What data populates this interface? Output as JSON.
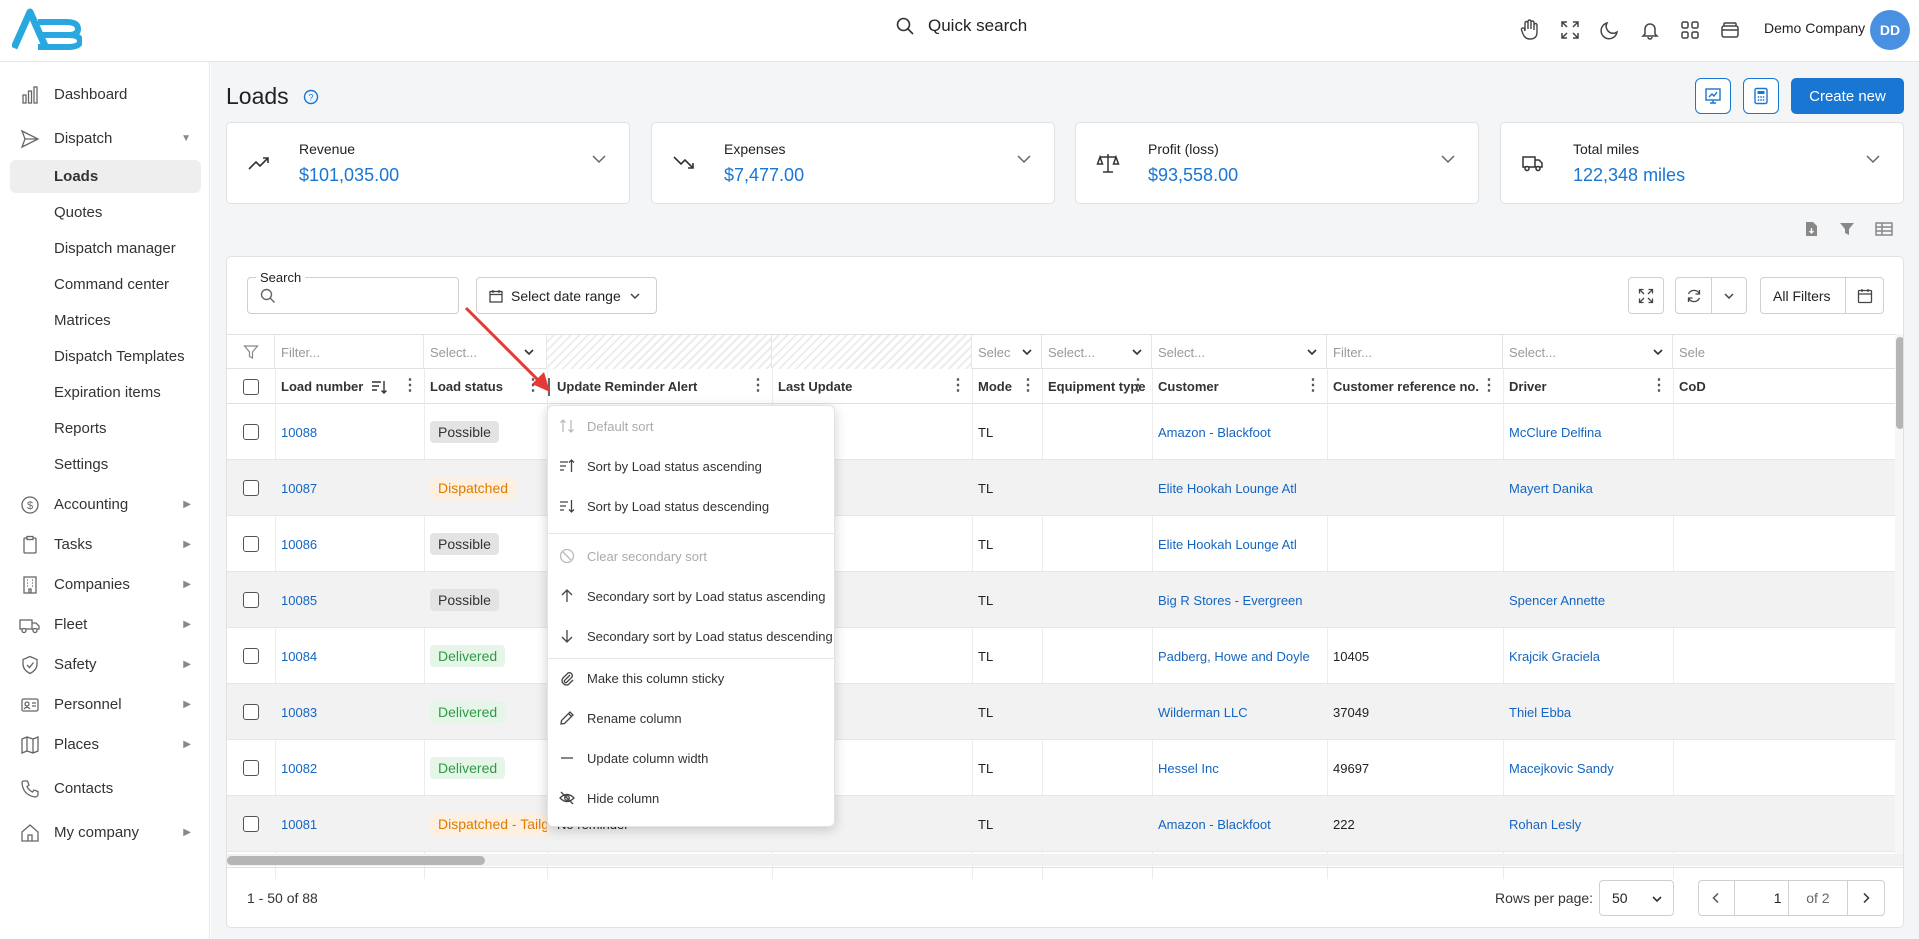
{
  "header": {
    "quick_search": "Quick search",
    "company": "Demo Company",
    "avatar_initials": "DD",
    "icons": [
      "hand-icon",
      "fullscreen-icon",
      "moon-icon",
      "bell-icon",
      "apps-grid-icon",
      "wallet-icon"
    ]
  },
  "sidebar": {
    "items": [
      {
        "label": "Dashboard",
        "icon": "chart-bars-icon"
      },
      {
        "label": "Dispatch",
        "icon": "send-icon",
        "expanded": true
      },
      {
        "label": "Loads",
        "sub": true,
        "active": true
      },
      {
        "label": "Quotes",
        "sub": true
      },
      {
        "label": "Dispatch manager",
        "sub": true
      },
      {
        "label": "Command center",
        "sub": true
      },
      {
        "label": "Matrices",
        "sub": true
      },
      {
        "label": "Dispatch Templates",
        "sub": true
      },
      {
        "label": "Expiration items",
        "sub": true
      },
      {
        "label": "Reports",
        "sub": true
      },
      {
        "label": "Settings",
        "sub": true
      },
      {
        "label": "Accounting",
        "icon": "dollar-coin-icon",
        "arrow": true
      },
      {
        "label": "Tasks",
        "icon": "clipboard-icon",
        "arrow": true
      },
      {
        "label": "Companies",
        "icon": "building-icon",
        "arrow": true
      },
      {
        "label": "Fleet",
        "icon": "truck-icon",
        "arrow": true
      },
      {
        "label": "Safety",
        "icon": "shield-check-icon",
        "arrow": true
      },
      {
        "label": "Personnel",
        "icon": "id-card-icon",
        "arrow": true
      },
      {
        "label": "Places",
        "icon": "map-icon",
        "arrow": true
      },
      {
        "label": "Contacts",
        "icon": "phone-icon"
      },
      {
        "label": "My company",
        "icon": "home-icon",
        "arrow": true
      }
    ]
  },
  "page": {
    "title": "Loads",
    "create_new": "Create new"
  },
  "kpis": [
    {
      "label": "Revenue",
      "value": "$101,035.00",
      "icon": "trend-up-icon"
    },
    {
      "label": "Expenses",
      "value": "$7,477.00",
      "icon": "trend-down-icon"
    },
    {
      "label": "Profit (loss)",
      "value": "$93,558.00",
      "icon": "scale-icon"
    },
    {
      "label": "Total miles",
      "value": "122,348 miles",
      "icon": "truck-icon"
    }
  ],
  "toolbar": {
    "search_label": "Search",
    "date_range": "Select date range",
    "all_filters": "All Filters"
  },
  "filters": {
    "filter_text": "Filter...",
    "select_text": "Select...",
    "mode_select": "Selec",
    "driver_next": "Sele"
  },
  "columns": [
    "Load number",
    "Load status",
    "Update Reminder Alert",
    "Last Update",
    "Mode",
    "Equipment type",
    "Customer",
    "Customer reference no.",
    "Driver",
    "CoD"
  ],
  "rows": [
    {
      "load": "10088",
      "status": "Possible",
      "mode": "TL",
      "customer": "Amazon - Blackfoot",
      "ref": "",
      "driver": "McClure Delfina"
    },
    {
      "load": "10087",
      "status": "Dispatched",
      "mode": "TL",
      "customer": "Elite Hookah Lounge Atl",
      "ref": "",
      "driver": "Mayert Danika"
    },
    {
      "load": "10086",
      "status": "Possible",
      "mode": "TL",
      "customer": "Elite Hookah Lounge Atl",
      "ref": "",
      "driver": ""
    },
    {
      "load": "10085",
      "status": "Possible",
      "mode": "TL",
      "customer": "Big R Stores - Evergreen",
      "ref": "",
      "driver": "Spencer Annette"
    },
    {
      "load": "10084",
      "status": "Delivered",
      "mode": "TL",
      "customer": "Padberg, Howe and Doyle",
      "ref": "10405",
      "driver": "Krajcik Graciela"
    },
    {
      "load": "10083",
      "status": "Delivered",
      "mode": "TL",
      "customer": "Wilderman LLC",
      "ref": "37049",
      "driver": "Thiel Ebba"
    },
    {
      "load": "10082",
      "status": "Delivered",
      "mode": "TL",
      "customer": "Hessel Inc",
      "ref": "49697",
      "driver": "Macejkovic Sandy"
    },
    {
      "load": "10081",
      "status": "Dispatched - Tailgat",
      "reminder": "No reminder",
      "mode": "TL",
      "customer": "Amazon - Blackfoot",
      "ref": "222",
      "driver": "Rohan Lesly"
    }
  ],
  "footer": {
    "count": "1 - 50 of 88",
    "rows_per_page_label": "Rows per page:",
    "rows_per_page": "50",
    "page": "1",
    "of_pages": "of 2"
  },
  "column_menu": {
    "items": [
      {
        "label": "Default sort",
        "disabled": true,
        "icon": "sort-default-icon"
      },
      {
        "label": "Sort by Load status ascending",
        "icon": "sort-ascending-icon"
      },
      {
        "label": "Sort by Load status descending",
        "icon": "sort-descending-icon"
      },
      {
        "label": "Clear secondary sort",
        "disabled": true,
        "icon": "clear-sort-icon"
      },
      {
        "label": "Secondary sort by Load status ascending",
        "icon": "arrow-up-icon"
      },
      {
        "label": "Secondary sort by Load status descending",
        "icon": "arrow-down-icon"
      },
      {
        "label": "Make this column sticky",
        "icon": "paperclip-icon"
      },
      {
        "label": "Rename column",
        "icon": "pencil-icon"
      },
      {
        "label": "Update column width",
        "icon": "minus-icon"
      },
      {
        "label": "Hide column",
        "icon": "eye-off-icon"
      }
    ]
  },
  "colors": {
    "accent": "#1976d2",
    "link": "#1565c0",
    "annotation_arrow": "#e53935"
  }
}
